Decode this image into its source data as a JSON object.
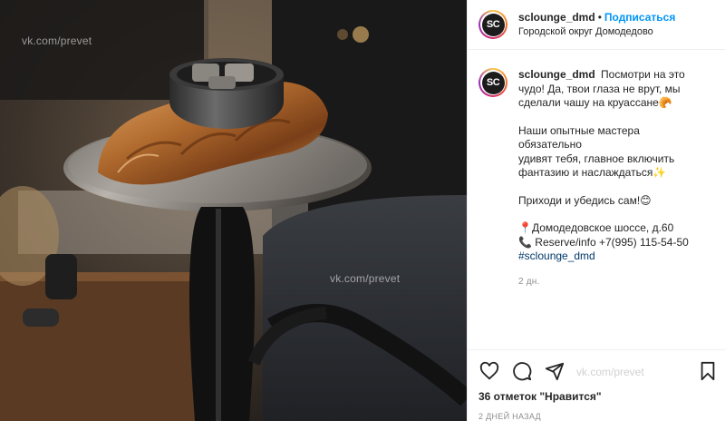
{
  "post": {
    "username": "sclounge_dmd",
    "avatar_text": "SC",
    "follow_label": "Подписаться",
    "separator": "•",
    "location": "Городской округ Домодедово",
    "caption": {
      "line1": "Посмотри на это",
      "line2": "чудо! Да, твои глаза не врут, мы",
      "line3": "сделали чашу на круассане🥐",
      "p2_line1": "Наши опытные мастера обязательно",
      "p2_line2": "удивят тебя, главное включить",
      "p2_line3": "фантазию и наслаждаться✨",
      "p3": "Приходи и убедись сам!😊",
      "address": "📍Домодедовское шоссе, д.60",
      "phone": "📞 Reserve/info +7(995) 115-54-50",
      "hashtag": "#sclounge_dmd"
    },
    "caption_age": "2 дн.",
    "likes": "36 отметок \"Нравится\"",
    "date": "2 ДНЕЙ НАЗАД"
  },
  "watermarks": {
    "top_left": "vk.com/prevet",
    "center": "vk.com/prevet",
    "panel": "vk.com/prevet"
  },
  "icons": [
    "heart-icon",
    "comment-icon",
    "share-icon",
    "bookmark-icon"
  ],
  "colors": {
    "follow": "#0095f6",
    "hashtag": "#00376b",
    "muted": "#8e8e8e"
  }
}
